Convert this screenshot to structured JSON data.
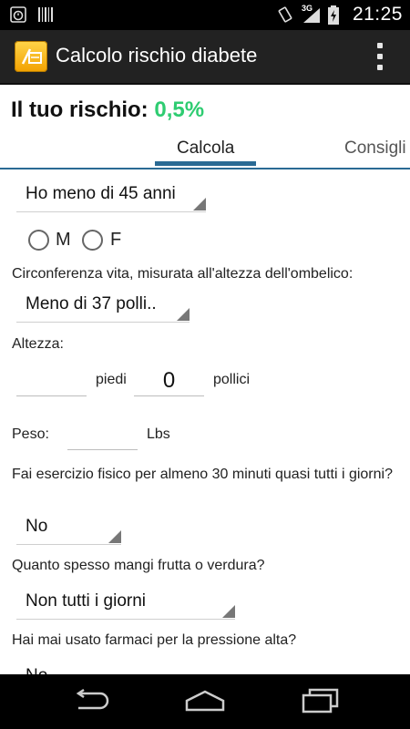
{
  "status_bar": {
    "time": "21:25",
    "network": "3G",
    "icons": [
      "alarm-icon",
      "barcode-icon",
      "vibrate-icon",
      "signal-icon",
      "battery-charging-icon"
    ]
  },
  "action_bar": {
    "title": "Calcolo rischio diabete",
    "app_icon": "app-logo-icon",
    "overflow_icon": "overflow-menu-icon"
  },
  "risk": {
    "label": "Il tuo rischio:",
    "value": "0,5%",
    "value_color": "#2ecc71"
  },
  "tabs": [
    {
      "label": "Calcola",
      "selected": true
    },
    {
      "label": "Consigli",
      "selected": false
    }
  ],
  "form": {
    "age_select": "Ho meno di 45 anni",
    "sex": {
      "option_m": "M",
      "option_f": "F"
    },
    "waist_label": "Circonferenza vita, misurata all'altezza dell'ombelico:",
    "waist_select": "Meno di 37 polli..",
    "height_label": "Altezza:",
    "height_feet_value": "",
    "height_feet_unit": "piedi",
    "height_inches_value": "0",
    "height_inches_unit": "pollici",
    "weight_label": "Peso:",
    "weight_value": "",
    "weight_unit": "Lbs",
    "exercise_label": "Fai esercizio fisico per almeno 30 minuti quasi tutti i giorni?",
    "exercise_select": "No",
    "fruit_label": "Quanto spesso mangi frutta o verdura?",
    "fruit_select": "Non tutti i giorni",
    "bp_meds_label": "Hai mai usato farmaci per la pressione alta?",
    "bp_meds_select": "No"
  },
  "nav_bar": {
    "back_icon": "back-icon",
    "home_icon": "home-icon",
    "recents_icon": "recent-apps-icon"
  },
  "colors": {
    "accent": "#2a6a94",
    "action_bar": "#222222"
  }
}
